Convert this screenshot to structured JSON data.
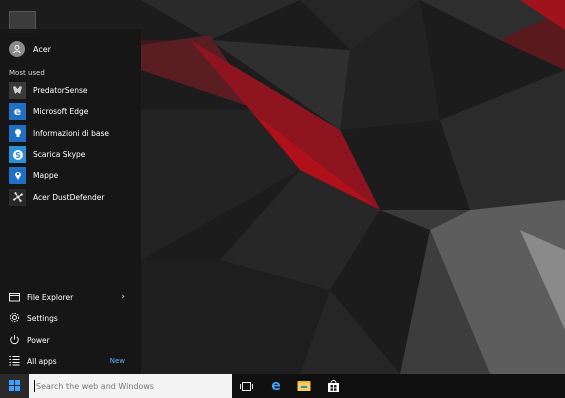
{
  "start_menu": {
    "user": {
      "name": "Acer",
      "icon": "user-avatar-icon"
    },
    "most_used_label": "Most used",
    "apps": [
      {
        "label": "PredatorSense",
        "icon": "predatorsense-icon",
        "tile_color": "#3a3a3a"
      },
      {
        "label": "Microsoft Edge",
        "icon": "edge-icon",
        "tile_color": "#1f6fc5"
      },
      {
        "label": "Informazioni di base",
        "icon": "lightbulb-icon",
        "tile_color": "#1f6fc5"
      },
      {
        "label": "Scarica Skype",
        "icon": "skype-icon",
        "tile_color": "#2a8fd6"
      },
      {
        "label": "Mappe",
        "icon": "maps-icon",
        "tile_color": "#1f6fc5"
      },
      {
        "label": "Acer DustDefender",
        "icon": "dustdefender-icon",
        "tile_color": "#2a2a2a"
      }
    ],
    "bottom": {
      "file_explorer": {
        "label": "File Explorer",
        "icon": "file-explorer-icon",
        "chevron": "›"
      },
      "settings": {
        "label": "Settings",
        "icon": "gear-icon"
      },
      "power": {
        "label": "Power",
        "icon": "power-icon"
      },
      "all_apps": {
        "label": "All apps",
        "icon": "list-icon",
        "badge": "New"
      }
    }
  },
  "taskbar": {
    "start_icon": "windows-logo-icon",
    "search": {
      "placeholder": "Search the web and Windows",
      "value": ""
    },
    "icons": [
      "task-view-icon",
      "edge-icon",
      "file-explorer-icon",
      "store-icon"
    ]
  },
  "colors": {
    "accent": "#5fb2ff",
    "wallpaper_red": "#b0101a"
  }
}
